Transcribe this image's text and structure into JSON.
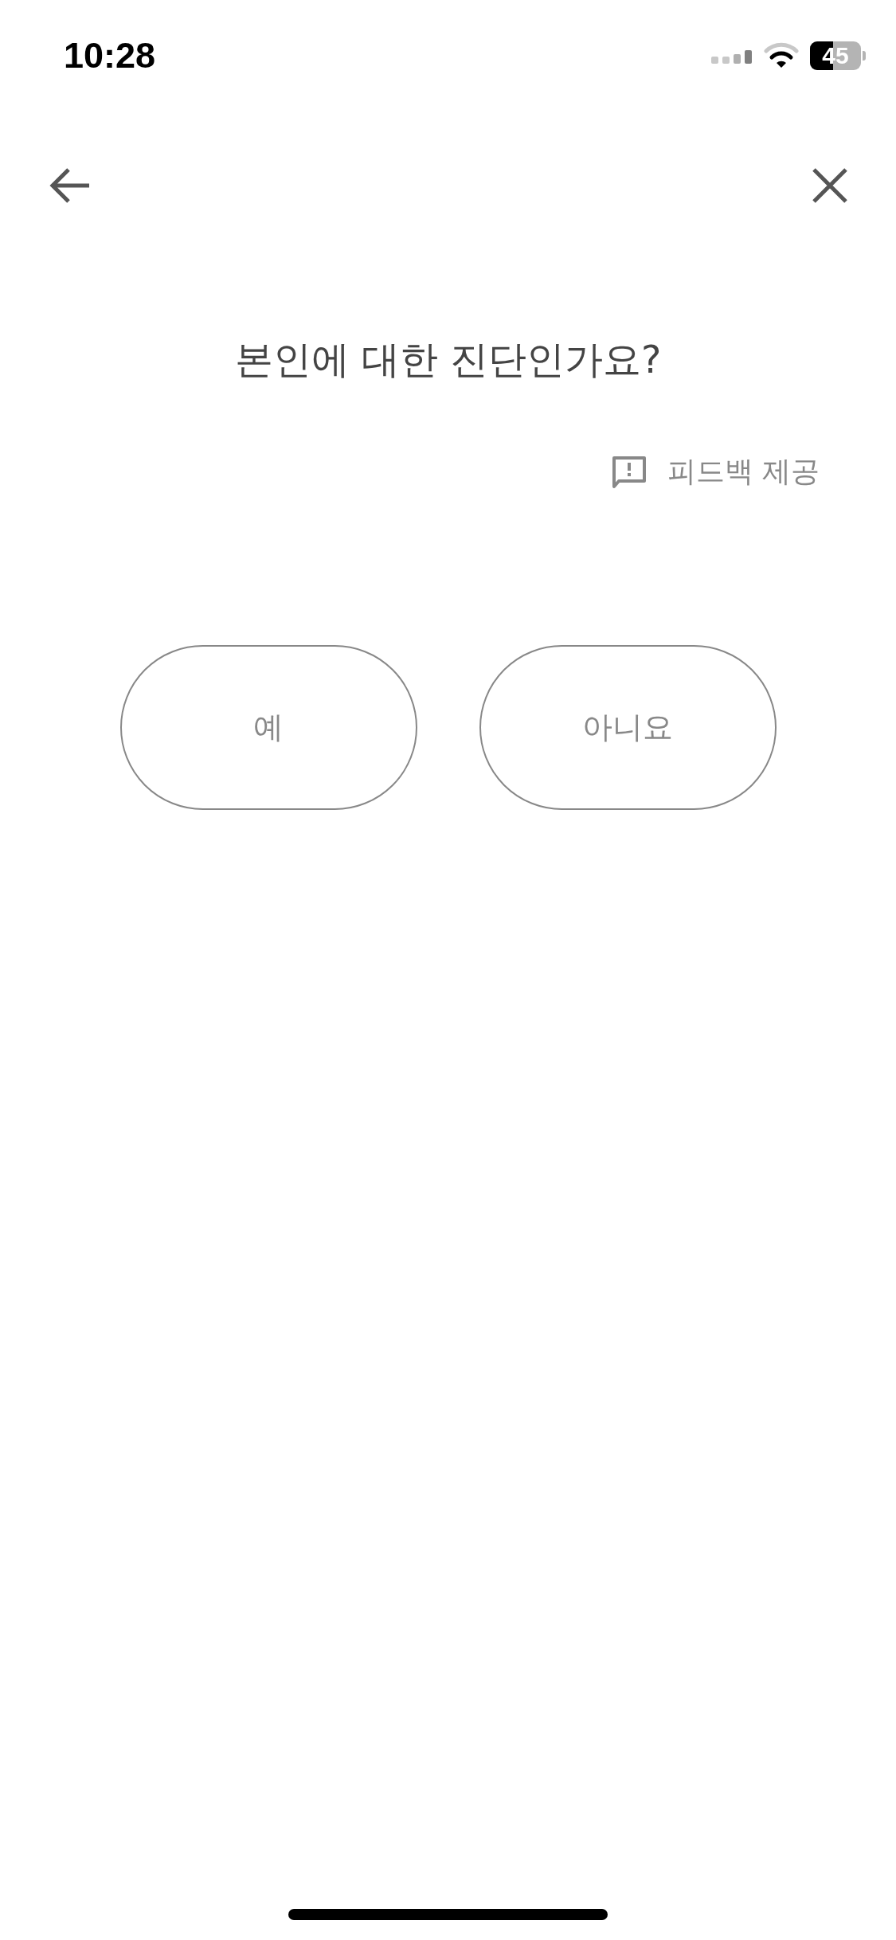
{
  "status_bar": {
    "time": "10:28",
    "battery": "45"
  },
  "question": "본인에 대한 진단인가요?",
  "feedback": {
    "label": "피드백 제공"
  },
  "answers": [
    {
      "label": "예"
    },
    {
      "label": "아니요"
    }
  ]
}
